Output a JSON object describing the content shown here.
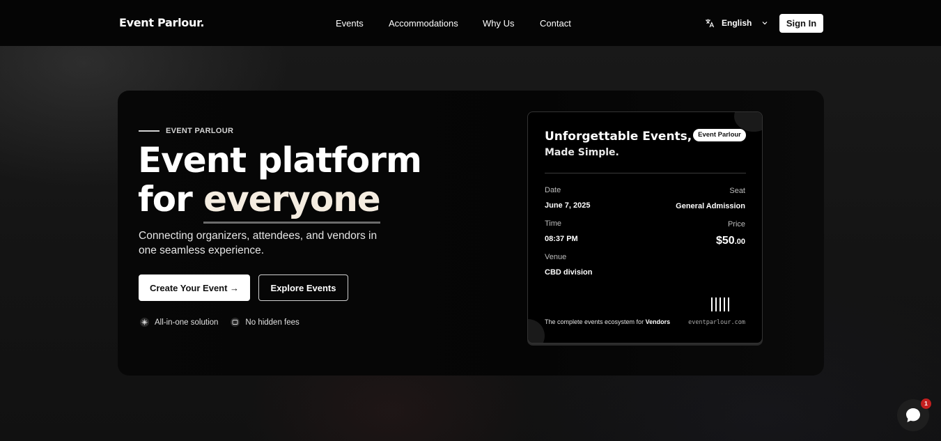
{
  "header": {
    "brand": "Event Parlour.",
    "nav": [
      "Events",
      "Accommodations",
      "Why Us",
      "Contact"
    ],
    "language": "English",
    "sign_in": "Sign In"
  },
  "hero": {
    "eyebrow": "EVENT PARLOUR",
    "headline_line1": "Event platform",
    "headline_for": "for ",
    "headline_highlight": "everyone",
    "subtitle": "Connecting organizers, attendees, and vendors in one seamless experience.",
    "cta_primary": "Create Your Event →",
    "cta_secondary": "Explore Events",
    "features": [
      "All-in-one solution",
      "No hidden fees"
    ]
  },
  "ticket": {
    "title": "Unforgettable Events,",
    "subtitle": "Made Simple.",
    "badge": "Event Parlour",
    "date_label": "Date",
    "date_value": "June 7, 2025",
    "seat_label": "Seat",
    "seat_value": "General Admission",
    "time_label": "Time",
    "time_value": "08:37 PM",
    "price_label": "Price",
    "price_main": "$50",
    "price_cents": ".00",
    "venue_label": "Venue",
    "venue_value": "CBD division",
    "footer_text": "The complete events ecosystem for ",
    "footer_bold": "Vendors",
    "url": "eventparlour.com"
  },
  "chat": {
    "unread": "1"
  },
  "colors": {
    "accent_highlight": "#f4ece0",
    "badge_red": "#c41f1f"
  }
}
